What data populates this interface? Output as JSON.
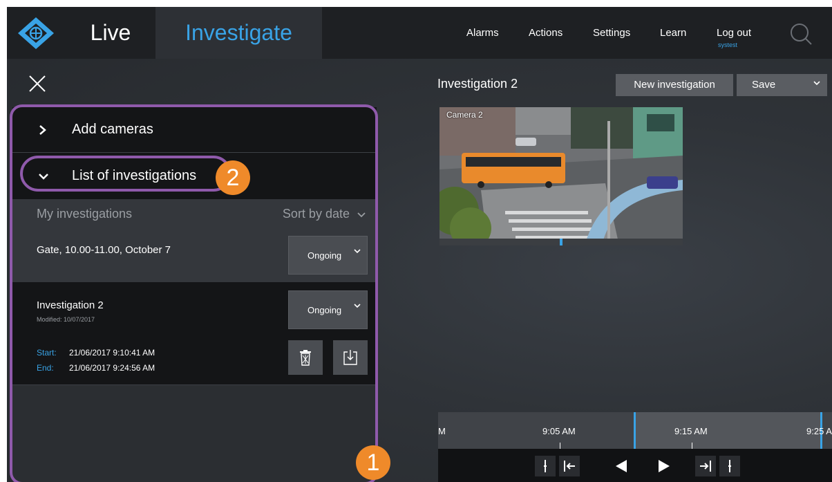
{
  "nav": {
    "tab_live": "Live",
    "tab_investigate": "Investigate",
    "menu": [
      "Alarms",
      "Actions",
      "Settings",
      "Learn",
      "Log out"
    ],
    "logout_user": "systest"
  },
  "panel": {
    "add_cameras": "Add cameras",
    "list_of_investigations": "List of investigations",
    "my_investigations": "My investigations",
    "sort_label": "Sort by date",
    "investigations": [
      {
        "name": "Gate, 10.00-11.00, October 7",
        "status": "Ongoing"
      },
      {
        "name": "Investigation 2",
        "modified": "Modified: 10/07/2017",
        "status": "Ongoing",
        "start_label": "Start:",
        "start": "21/06/2017 9:10:41 AM",
        "end_label": "End:",
        "end": "21/06/2017 9:24:56 AM"
      }
    ]
  },
  "callouts": {
    "one": "1",
    "two": "2"
  },
  "main": {
    "title": "Investigation 2",
    "new_investigation": "New investigation",
    "save": "Save",
    "camera_label": "Camera 2"
  },
  "timeline": {
    "labels": [
      "M",
      "9:05 AM",
      "9:15 AM",
      "9:25 A"
    ]
  },
  "colors": {
    "accent": "#39a3e6",
    "callout_orange": "#ef8a2a",
    "highlight_purple": "#8f5aab"
  }
}
